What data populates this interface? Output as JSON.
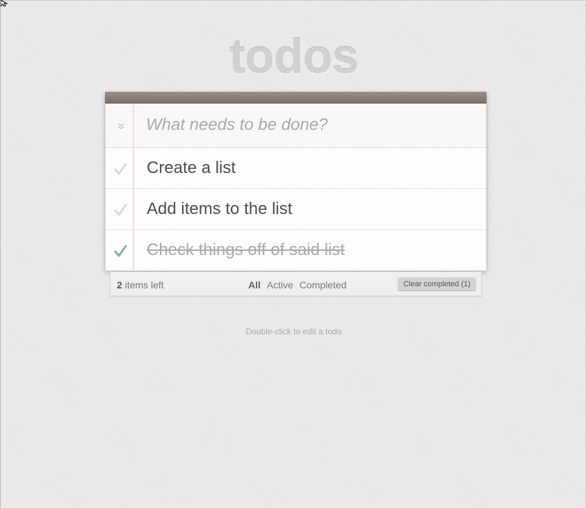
{
  "app": {
    "title": "todos"
  },
  "new_todo": {
    "placeholder": "What needs to be done?",
    "value": ""
  },
  "toggle_all": {
    "icon": "double-chevron-down-icon"
  },
  "todos": [
    {
      "label": "Create a list",
      "completed": false
    },
    {
      "label": "Add items to the list",
      "completed": false
    },
    {
      "label": "Check things off of said list",
      "completed": true
    }
  ],
  "footer": {
    "count": "2",
    "count_suffix": " items left",
    "filters": [
      {
        "label": "All",
        "selected": true
      },
      {
        "label": "Active",
        "selected": false
      },
      {
        "label": "Completed",
        "selected": false
      }
    ],
    "clear_label": "Clear completed (1)"
  },
  "info": {
    "text": "Double-click to edit a todo"
  },
  "colors": {
    "title": "#d0d0d0",
    "topbar": "#8d7f79",
    "check_done": "#85ada7",
    "check_pending": "#d9d9d9",
    "completed_text": "#a9a9a9",
    "background": "#eaeaea"
  }
}
